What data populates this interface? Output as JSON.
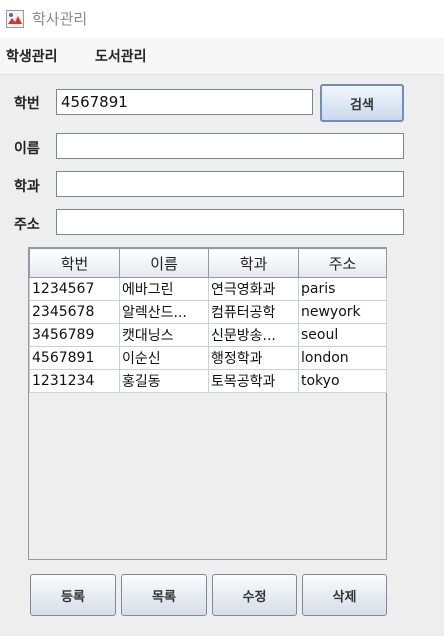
{
  "window": {
    "title": "학사관리",
    "icon": "app-window-icon"
  },
  "menu": {
    "items": [
      "학생관리",
      "도서관리"
    ]
  },
  "form": {
    "labels": {
      "student_id": "학번",
      "name": "이름",
      "department": "학과",
      "address": "주소"
    },
    "values": {
      "student_id": "4567891",
      "name": "",
      "department": "",
      "address": ""
    },
    "search_button": "검색"
  },
  "table": {
    "columns": [
      "학번",
      "이름",
      "학과",
      "주소"
    ],
    "rows": [
      [
        "1234567",
        "에바그린",
        "연극영화과",
        "paris"
      ],
      [
        "2345678",
        "알렉산드...",
        "컴퓨터공학",
        "newyork"
      ],
      [
        "3456789",
        "캣대닝스",
        "신문방송...",
        "seoul"
      ],
      [
        "4567891",
        "이순신",
        "행정학과",
        "london"
      ],
      [
        "1231234",
        "홍길동",
        "토목공학과",
        "tokyo"
      ]
    ]
  },
  "buttons": {
    "register": "등록",
    "list": "목록",
    "edit": "수정",
    "delete": "삭제"
  }
}
